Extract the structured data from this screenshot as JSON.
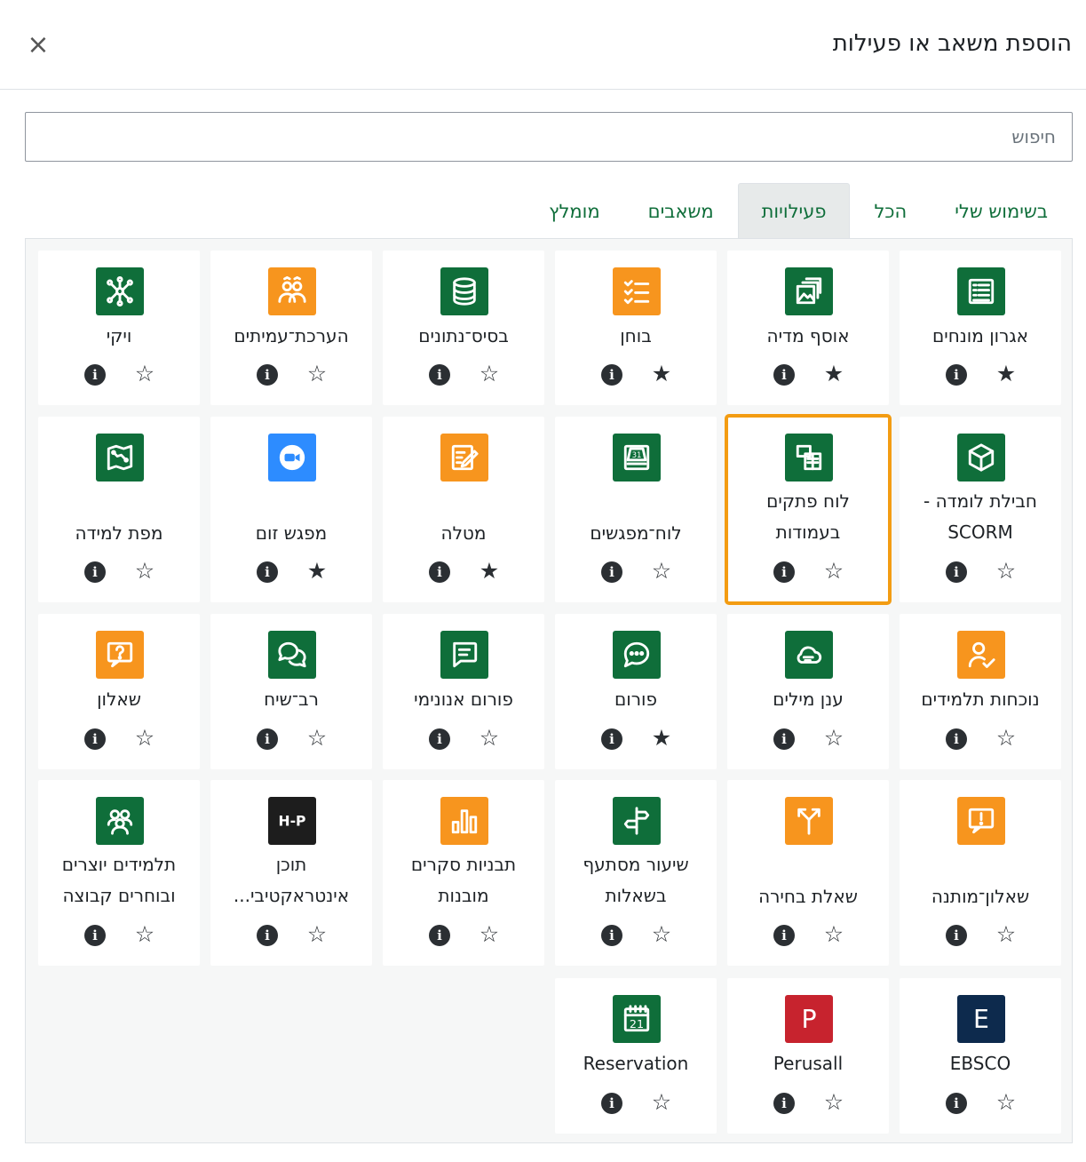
{
  "modal": {
    "title": "הוספת משאב או פעילות",
    "close_label": "×"
  },
  "search": {
    "placeholder": "חיפוש"
  },
  "tabs": [
    {
      "label": "בשימוש שלי",
      "active": false
    },
    {
      "label": "הכל",
      "active": false
    },
    {
      "label": "פעילויות",
      "active": true
    },
    {
      "label": "משאבים",
      "active": false
    },
    {
      "label": "מומלץ",
      "active": false
    }
  ],
  "info_label": "i",
  "star_filled": "★",
  "star_empty": "☆",
  "modules": [
    {
      "name": "אגרון מונחים",
      "icon": "list-icon",
      "color": "#0f6e3a",
      "starred": true
    },
    {
      "name": "אוסף מדיה",
      "icon": "media-gallery-icon",
      "color": "#0f6e3a",
      "starred": true
    },
    {
      "name": "בוחן",
      "icon": "checklist-icon",
      "color": "#f7951e",
      "starred": true
    },
    {
      "name": "בסיס־נתונים",
      "icon": "database-icon",
      "color": "#0f6e3a",
      "starred": false
    },
    {
      "name": "הערכת־עמיתים",
      "icon": "peer-review-icon",
      "color": "#f7951e",
      "starred": false
    },
    {
      "name": "ויקי",
      "icon": "network-icon",
      "color": "#0f6e3a",
      "starred": false
    },
    {
      "name": "חבילת לומדה - SCORM",
      "icon": "cube-icon",
      "color": "#0f6e3a",
      "starred": false
    },
    {
      "name": "לוח פתקים בעמודות",
      "icon": "sticky-board-icon",
      "color": "#0f6e3a",
      "starred": false,
      "selected": true
    },
    {
      "name": "לוח־מפגשים",
      "icon": "calendar-31-icon",
      "color": "#0f6e3a",
      "starred": false
    },
    {
      "name": "מטלה",
      "icon": "assignment-edit-icon",
      "color": "#f7951e",
      "starred": true
    },
    {
      "name": "מפגש זום",
      "icon": "zoom-camera-icon",
      "color": "#2d8cff",
      "starred": true
    },
    {
      "name": "מפת למידה",
      "icon": "map-icon",
      "color": "#0f6e3a",
      "starred": false
    },
    {
      "name": "נוכחות תלמידים",
      "icon": "attendance-user-icon",
      "color": "#f7951e",
      "starred": false
    },
    {
      "name": "ענן מילים",
      "icon": "cloud-icon",
      "color": "#0f6e3a",
      "starred": false
    },
    {
      "name": "פורום",
      "icon": "chat-bubble-icon",
      "color": "#0f6e3a",
      "starred": true
    },
    {
      "name": "פורום אנונימי",
      "icon": "message-icon",
      "color": "#0f6e3a",
      "starred": false
    },
    {
      "name": "רב־שיח",
      "icon": "chat-bubbles-icon",
      "color": "#0f6e3a",
      "starred": false
    },
    {
      "name": "שאלון",
      "icon": "question-icon",
      "color": "#f7951e",
      "starred": false
    },
    {
      "name": "שאלון־מותנה",
      "icon": "alert-message-icon",
      "color": "#f7951e",
      "starred": false
    },
    {
      "name": "שאלת בחירה",
      "icon": "branch-choice-icon",
      "color": "#f7951e",
      "starred": false
    },
    {
      "name": "שיעור מסתעף בשאלות",
      "icon": "signpost-icon",
      "color": "#0f6e3a",
      "starred": false
    },
    {
      "name": "תבניות סקרים מובנות",
      "icon": "bar-chart-icon",
      "color": "#f7951e",
      "starred": false
    },
    {
      "name": "תוכן אינטראקטיבי...",
      "icon": "h5p-icon",
      "color": "#1d1d1d",
      "starred": false
    },
    {
      "name": "תלמידים יוצרים ובוחרים קבוצה",
      "icon": "group-icon",
      "color": "#0f6e3a",
      "starred": false
    },
    {
      "name": "EBSCO",
      "icon": "ebsco-e-icon",
      "color": "#0d2a4d",
      "starred": false
    },
    {
      "name": "Perusall",
      "icon": "perusall-p-icon",
      "color": "#c7232e",
      "starred": false
    },
    {
      "name": "Reservation",
      "icon": "calendar-21-icon",
      "color": "#0f6e3a",
      "starred": false
    }
  ]
}
